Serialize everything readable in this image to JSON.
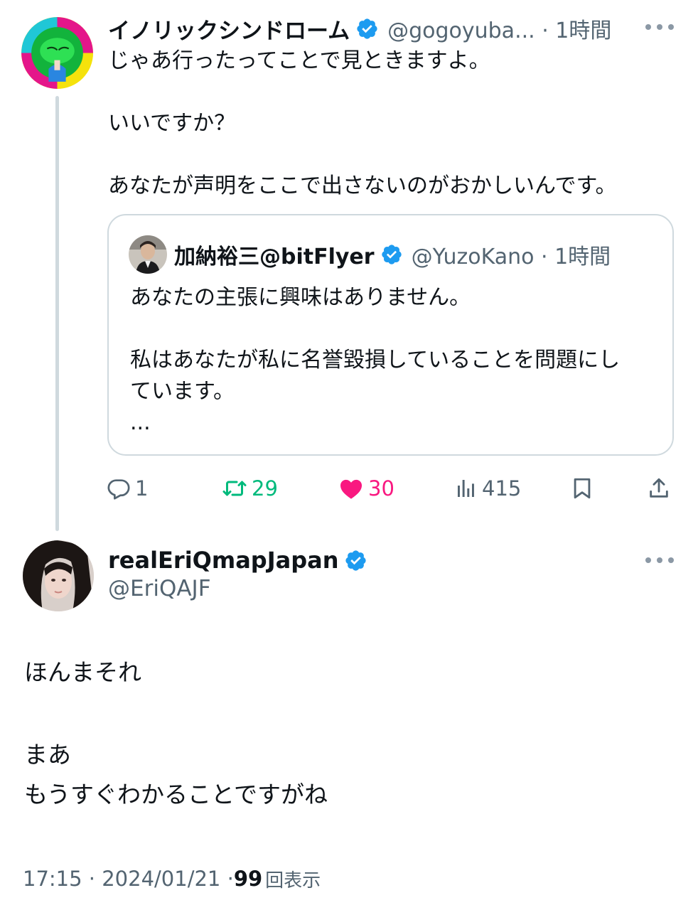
{
  "parent_tweet": {
    "display_name": "イノリックシンドローム",
    "handle_time": "@gogoyuba... · 1時間",
    "text_lines": [
      "じゃあ行ったってことで見ときますよ。",
      "",
      "いいですか？",
      "",
      "あなたが声明をここで出さないのがおかしいんです。"
    ],
    "quote": {
      "display_name": "加納裕三@bitFlyer",
      "handle_time": "@YuzoKano · 1時間",
      "text_lines": [
        "あなたの主張に興味はありません。",
        "",
        "私はあなたが私に名誉毀損していることを問題にし",
        "ています。",
        "..."
      ]
    },
    "actions": {
      "replies": "1",
      "retweets": "29",
      "likes": "30",
      "views": "415"
    }
  },
  "reply_tweet": {
    "display_name": "realEriQmapJapan",
    "handle": "@EriQAJF",
    "text_lines": [
      "ほんまそれ",
      "",
      "まあ",
      "もうすぐわかることですがね"
    ],
    "timestamp": "17:15 · 2024/01/21 · ",
    "views_count": "99",
    "views_label": "回表示"
  },
  "colors": {
    "verified_blue": "#1d9bf0",
    "retweet_green": "#00ba7c",
    "like_pink": "#f91880",
    "secondary_text": "#536471"
  }
}
